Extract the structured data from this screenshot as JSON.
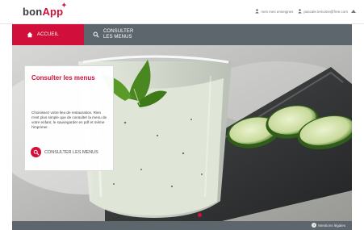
{
  "brand": {
    "logo_main": "bon",
    "logo_accent": "App"
  },
  "header": {
    "profile_link": "mes mes enseignes",
    "email_link": "pascale.lemoine@free.com"
  },
  "nav": {
    "home_label": "ACCUEIL",
    "menu_label": "Consulter les MENUS"
  },
  "card": {
    "title": "Consulter les menus",
    "description": "Choisissez votre lieu de restauration. Rien n'est plus simple que de consulter la menu de votre enfant, le sauvegarder en pdf et même l'imprimer.",
    "button_label": "CONSULTER LES MENUS"
  },
  "footer": {
    "legal_link": "Mentions légales"
  },
  "colors": {
    "accent": "#d0103a",
    "nav": "#5d656d",
    "text": "#444444"
  },
  "icons": {
    "home": "home-icon",
    "search": "search-icon",
    "user": "user-icon",
    "caret": "caret-up-icon",
    "info": "info-icon"
  }
}
